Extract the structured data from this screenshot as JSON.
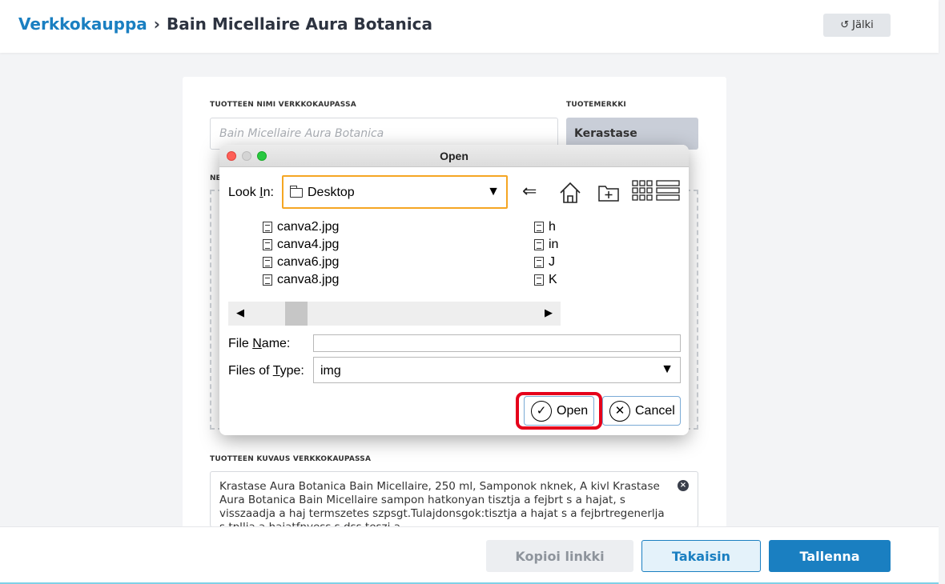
{
  "header": {
    "breadcrumb_root": "Verkkokauppa",
    "breadcrumb_sep": "›",
    "breadcrumb_current": "Bain Micellaire Aura Botanica",
    "back_label": "Jälki",
    "back_icon": "↺"
  },
  "form": {
    "name_label": "TUOTTEEN NIMI VERKKOKAUPASSA",
    "name_placeholder": "Bain Micellaire Aura Botanica",
    "brand_label": "TUOTEMERKKI",
    "brand_value": "Kerastase",
    "image_label_partial": "NE",
    "desc_label": "TUOTTEEN KUVAUS VERKKOKAUPASSA",
    "desc_text": "Krastase Aura Botanica Bain Micellaire, 250 ml, Samponok nknek, A kivl Krastase Aura Botanica Bain Micellaire sampon hatkonyan tisztja a fejbrt s a hajat, s visszaadja a haj termszetes szpsgt.Tulajdonsgok:tisztja a hajat s a fejbrtregenerlja s tpllja a hajatfnyess s dss teszi a"
  },
  "footer": {
    "copy_label": "Kopioi linkki",
    "back_label": "Takaisin",
    "save_label": "Tallenna"
  },
  "dialog": {
    "title": "Open",
    "look_in_value": "Desktop",
    "files_left": [
      "canva2.jpg",
      "canva4.jpg",
      "canva6.jpg",
      "canva8.jpg"
    ],
    "files_right": [
      "h",
      "in",
      "J",
      "K"
    ],
    "file_name_value": "",
    "file_type_value": "img",
    "open_label": "Open",
    "cancel_label": "Cancel",
    "toolbar_icons": [
      "back-arrow-icon",
      "home-icon",
      "new-folder-icon",
      "list-view-icon",
      "details-view-icon"
    ]
  },
  "colors": {
    "brand_blue": "#1a7fc1",
    "highlight_red": "#e5001b",
    "lookin_border": "#f5a623"
  }
}
